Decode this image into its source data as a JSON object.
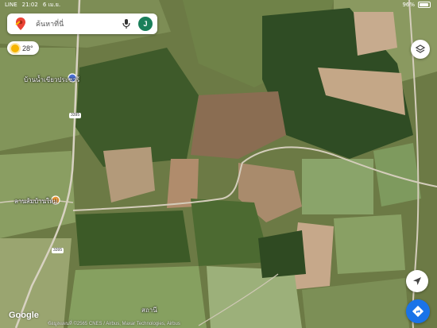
{
  "status_bar": {
    "carrier": "LINE",
    "time": "21:02",
    "date": "6 เม.ย.",
    "battery": "96%",
    "battery_level": 0.96
  },
  "search": {
    "placeholder": "ค้นหาที่นี่",
    "avatar_initial": "J"
  },
  "weather": {
    "temperature": "28°"
  },
  "map": {
    "place_labels": [
      "บ้านน้ำเขียวประชาร้",
      "ลานส้มบ้านใหม่",
      "สถานี"
    ],
    "road_shields": [
      "3395",
      "3395"
    ],
    "google_logo": "Google",
    "attribution": "ข้อมูลแผนที่ ©2565 CNES / Airbus, Maxar Technologies, Airbus"
  },
  "colors": {
    "accent": "#1a73e8",
    "avatar": "#1a7f5a",
    "weather_sun": "#f6b400",
    "poi_blue": "#4a6fd4",
    "poi_orange": "#f09a34"
  },
  "icons": [
    "google-maps-logo-icon",
    "microphone-icon",
    "sun-icon",
    "layers-icon",
    "navigation-arrow-icon",
    "directions-icon"
  ]
}
